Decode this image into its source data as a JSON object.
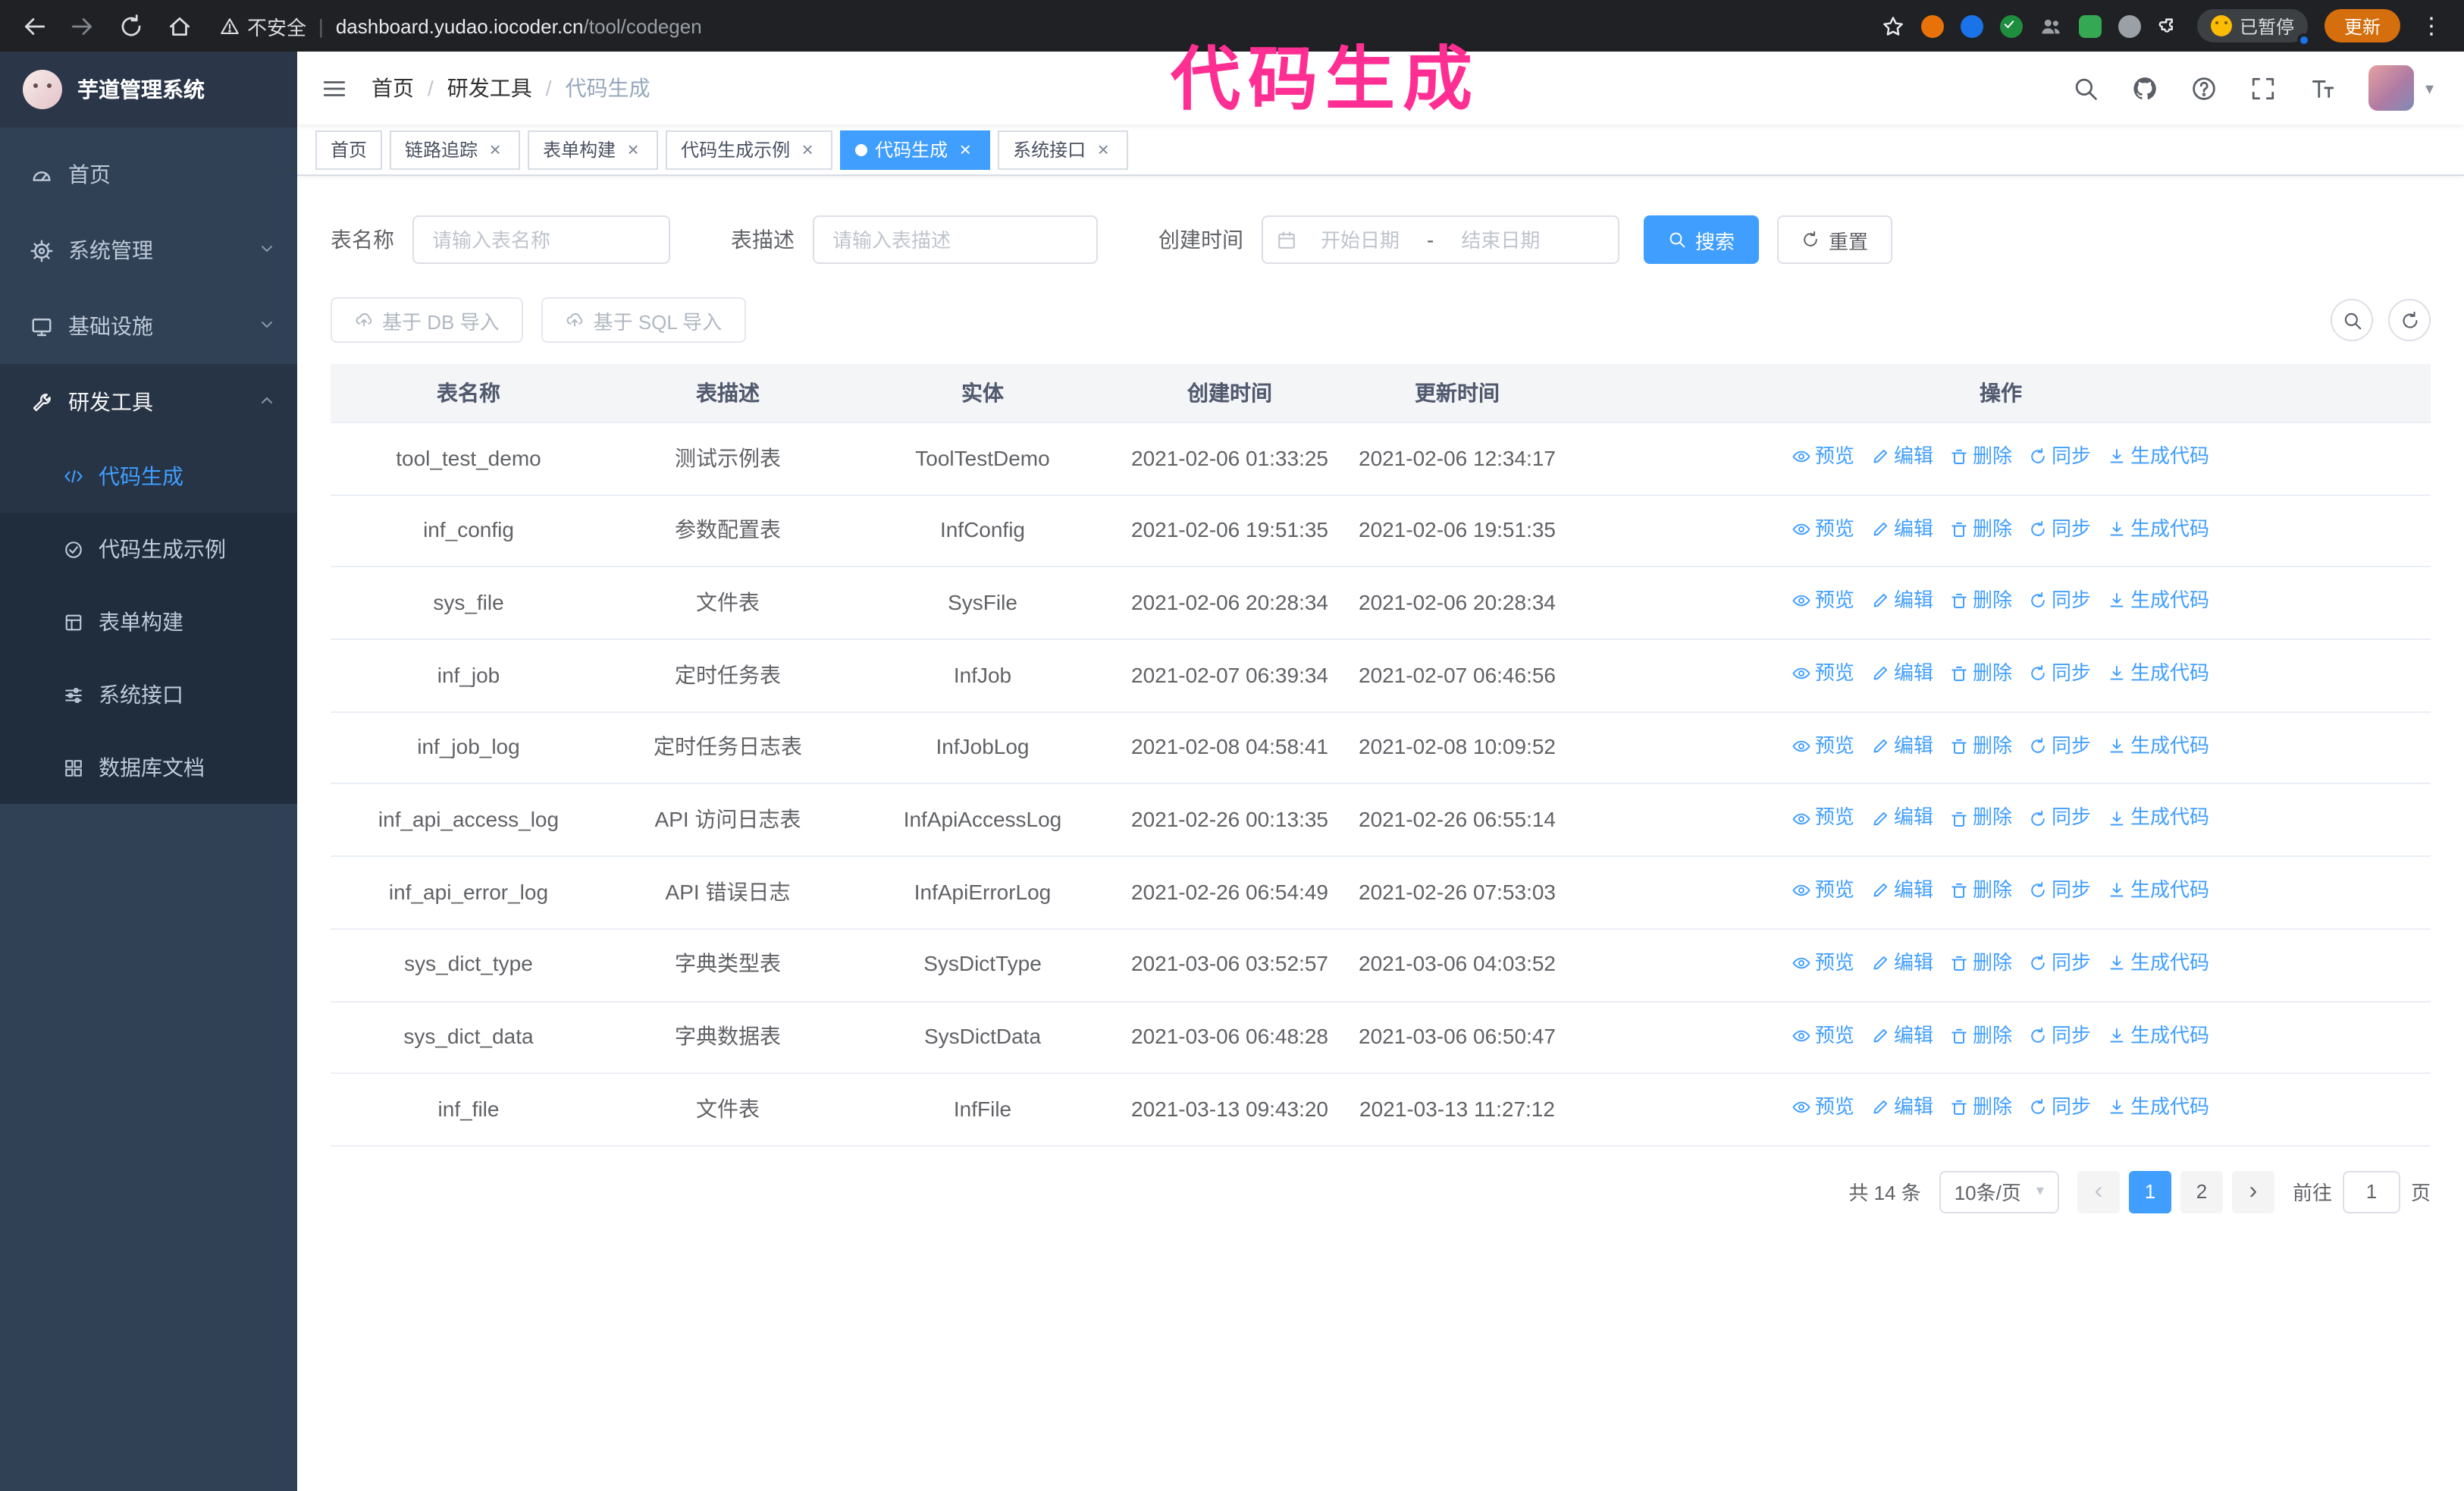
{
  "overlay": {
    "title": "代码生成"
  },
  "browser": {
    "security_label": "不安全",
    "url_host": "dashboard.yudao.iocoder.cn",
    "url_path": "/tool/codegen",
    "paused_badge": "已暂停",
    "update_button": "更新"
  },
  "icons": {
    "close": "×",
    "slash": "/",
    "caret": "▾",
    "kebab": "⋮",
    "divider": "|",
    "prev": "‹",
    "next": "›"
  },
  "sidebar": {
    "app_title": "芋道管理系统",
    "items": [
      {
        "label": "首页"
      },
      {
        "label": "系统管理"
      },
      {
        "label": "基础设施"
      },
      {
        "label": "研发工具"
      }
    ],
    "sub_items": [
      {
        "label": "代码生成"
      },
      {
        "label": "代码生成示例"
      },
      {
        "label": "表单构建"
      },
      {
        "label": "系统接口"
      },
      {
        "label": "数据库文档"
      }
    ]
  },
  "breadcrumb": {
    "items": [
      "首页",
      "研发工具",
      "代码生成"
    ]
  },
  "tabs": [
    {
      "label": "首页",
      "closable": false,
      "active": false
    },
    {
      "label": "链路追踪",
      "closable": true,
      "active": false
    },
    {
      "label": "表单构建",
      "closable": true,
      "active": false
    },
    {
      "label": "代码生成示例",
      "closable": true,
      "active": false
    },
    {
      "label": "代码生成",
      "closable": true,
      "active": true
    },
    {
      "label": "系统接口",
      "closable": true,
      "active": false
    }
  ],
  "filters": {
    "table_name_label": "表名称",
    "table_name_placeholder": "请输入表名称",
    "table_desc_label": "表描述",
    "table_desc_placeholder": "请输入表描述",
    "create_time_label": "创建时间",
    "date_start_placeholder": "开始日期",
    "date_separator": "-",
    "date_end_placeholder": "结束日期",
    "search_button": "搜索",
    "reset_button": "重置"
  },
  "toolbar": {
    "import_db_button": "基于 DB 导入",
    "import_sql_button": "基于 SQL 导入"
  },
  "table": {
    "columns": [
      "表名称",
      "表描述",
      "实体",
      "创建时间",
      "更新时间",
      "操作"
    ],
    "actions": [
      "预览",
      "编辑",
      "删除",
      "同步",
      "生成代码"
    ],
    "rows": [
      {
        "name": "tool_test_demo",
        "desc": "测试示例表",
        "entity": "ToolTestDemo",
        "created": "2021-02-06 01:33:25",
        "updated": "2021-02-06 12:34:17"
      },
      {
        "name": "inf_config",
        "desc": "参数配置表",
        "entity": "InfConfig",
        "created": "2021-02-06 19:51:35",
        "updated": "2021-02-06 19:51:35"
      },
      {
        "name": "sys_file",
        "desc": "文件表",
        "entity": "SysFile",
        "created": "2021-02-06 20:28:34",
        "updated": "2021-02-06 20:28:34"
      },
      {
        "name": "inf_job",
        "desc": "定时任务表",
        "entity": "InfJob",
        "created": "2021-02-07 06:39:34",
        "updated": "2021-02-07 06:46:56"
      },
      {
        "name": "inf_job_log",
        "desc": "定时任务日志表",
        "entity": "InfJobLog",
        "created": "2021-02-08 04:58:41",
        "updated": "2021-02-08 10:09:52"
      },
      {
        "name": "inf_api_access_log",
        "desc": "API 访问日志表",
        "entity": "InfApiAccessLog",
        "created": "2021-02-26 00:13:35",
        "updated": "2021-02-26 06:55:14"
      },
      {
        "name": "inf_api_error_log",
        "desc": "API 错误日志",
        "entity": "InfApiErrorLog",
        "created": "2021-02-26 06:54:49",
        "updated": "2021-02-26 07:53:03"
      },
      {
        "name": "sys_dict_type",
        "desc": "字典类型表",
        "entity": "SysDictType",
        "created": "2021-03-06 03:52:57",
        "updated": "2021-03-06 04:03:52"
      },
      {
        "name": "sys_dict_data",
        "desc": "字典数据表",
        "entity": "SysDictData",
        "created": "2021-03-06 06:48:28",
        "updated": "2021-03-06 06:50:47"
      },
      {
        "name": "inf_file",
        "desc": "文件表",
        "entity": "InfFile",
        "created": "2021-03-13 09:43:20",
        "updated": "2021-03-13 11:27:12"
      }
    ]
  },
  "pagination": {
    "total_text": "共 14 条",
    "page_size": "10条/页",
    "pages": [
      "1",
      "2"
    ],
    "current_page": "1",
    "goto_label": "前往",
    "goto_value": "1",
    "goto_suffix": "页"
  },
  "colors": {
    "accent": "#409eff",
    "sidebar_bg": "#304156",
    "submenu_bg": "#1f2d3d",
    "overlay_pink": "#ff2e92",
    "browser_bar": "#202124"
  }
}
